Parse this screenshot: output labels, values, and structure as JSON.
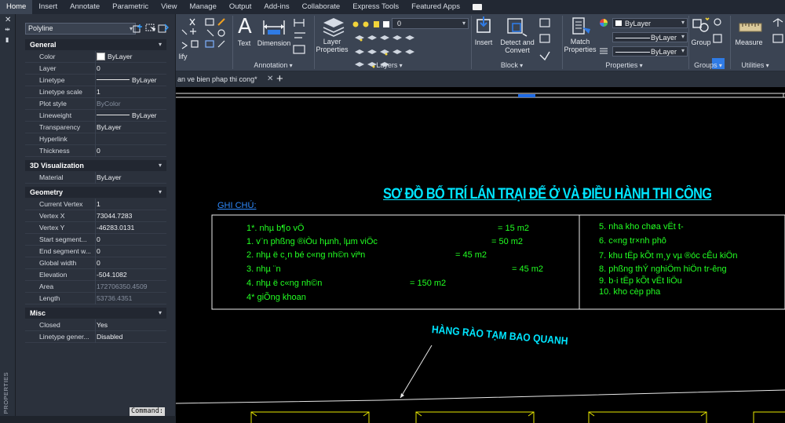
{
  "ribbon_tabs": [
    "Home",
    "Insert",
    "Annotate",
    "Parametric",
    "View",
    "Manage",
    "Output",
    "Add-ins",
    "Collaborate",
    "Express Tools",
    "Featured Apps"
  ],
  "active_tab": "Home",
  "ribbon": {
    "text_label": "Text",
    "dimension_label": "Dimension",
    "annotation_panel": "Annotation",
    "layer_properties_label": "Layer Properties",
    "layer_value": "0",
    "layers_panel": "Layers",
    "insert_label": "Insert",
    "detect_label": "Detect and Convert",
    "block_panel": "Block",
    "match_label": "Match Properties",
    "color_value": "ByLayer",
    "linetype_value": "ByLayer",
    "lineweight_value": "ByLayer",
    "properties_panel": "Properties",
    "group_label": "Group",
    "groups_panel": "Groups",
    "measure_label": "Measure",
    "utilities_panel": "Utilities",
    "modify_partial": "lify"
  },
  "doc_tab": {
    "name": "an ve bien phap thi cong*",
    "close": "✕",
    "new_tab": "+"
  },
  "properties": {
    "object_type": "Polyline",
    "sections": [
      {
        "name": "General",
        "rows": [
          {
            "label": "Color",
            "value": "ByLayer",
            "kind": "color"
          },
          {
            "label": "Layer",
            "value": "0"
          },
          {
            "label": "Linetype",
            "value": "ByLayer",
            "kind": "line"
          },
          {
            "label": "Linetype scale",
            "value": "1"
          },
          {
            "label": "Plot style",
            "value": "ByColor",
            "dim": true
          },
          {
            "label": "Lineweight",
            "value": "ByLayer",
            "kind": "line"
          },
          {
            "label": "Transparency",
            "value": "ByLayer"
          },
          {
            "label": "Hyperlink",
            "value": ""
          },
          {
            "label": "Thickness",
            "value": "0"
          }
        ]
      },
      {
        "name": "3D Visualization",
        "rows": [
          {
            "label": "Material",
            "value": "ByLayer"
          }
        ]
      },
      {
        "name": "Geometry",
        "rows": [
          {
            "label": "Current Vertex",
            "value": "1"
          },
          {
            "label": "Vertex X",
            "value": "73044.7283"
          },
          {
            "label": "Vertex Y",
            "value": "-46283.0131"
          },
          {
            "label": "Start segment...",
            "value": "0"
          },
          {
            "label": "End segment w...",
            "value": "0"
          },
          {
            "label": "Global width",
            "value": "0"
          },
          {
            "label": "Elevation",
            "value": "-504.1082"
          },
          {
            "label": "Area",
            "value": "172706350.4509",
            "dim": true
          },
          {
            "label": "Length",
            "value": "53736.4351",
            "dim": true
          }
        ]
      },
      {
        "name": "Misc",
        "rows": [
          {
            "label": "Closed",
            "value": "Yes"
          },
          {
            "label": "Linetype gener...",
            "value": "Disabled"
          }
        ]
      }
    ],
    "palette_title": "PROPERTIES",
    "command_label": "Command:"
  },
  "drawing": {
    "title": "SƠ ĐỒ BỐ TRÍ LÁN TRẠI ĐỂ Ở VÀ ĐIỀU HÀNH THI CÔNG",
    "notes_label": "GHI CHÚ:",
    "left_items": [
      {
        "text": "1*. nhµ b¶o vÖ",
        "area": "= 15 m2"
      },
      {
        "text": "1. v¨n phßng ®iÒu hµnh, lµm viÖc",
        "area": "= 50 m2"
      },
      {
        "text": "2. nhµ ë c¸n bé c«ng nh©n viªn",
        "area": "= 45 m2"
      },
      {
        "text": "3. nhµ ¨n",
        "area": "= 45 m2"
      },
      {
        "text": "4. nhµ ë c«ng nh©n",
        "area": "= 150 m2"
      },
      {
        "text": "4* giÕng khoan",
        "area": ""
      }
    ],
    "right_items": [
      "5. nha kho chøa vËt t-",
      "6. c«ng tr×nh phô",
      "7. khu tËp kÕt m¸y vµ ®óc cÊu kiÖn",
      "8. phßng thÝ nghiÖm hiÖn tr-êng",
      "9. b·i tËp kÕt vËt liÖu",
      "10. kho cèp pha"
    ],
    "fence_label": "HÀNG RÀO TẠM BAO QUANH"
  },
  "colors": {
    "ribbon_bg": "#3b4453",
    "tabbar_bg": "#222833",
    "palette_bg": "#2b313c",
    "title_cyan": "#00e5ff",
    "note_green": "#22ff22",
    "fence_yellow": "#e8e800"
  }
}
